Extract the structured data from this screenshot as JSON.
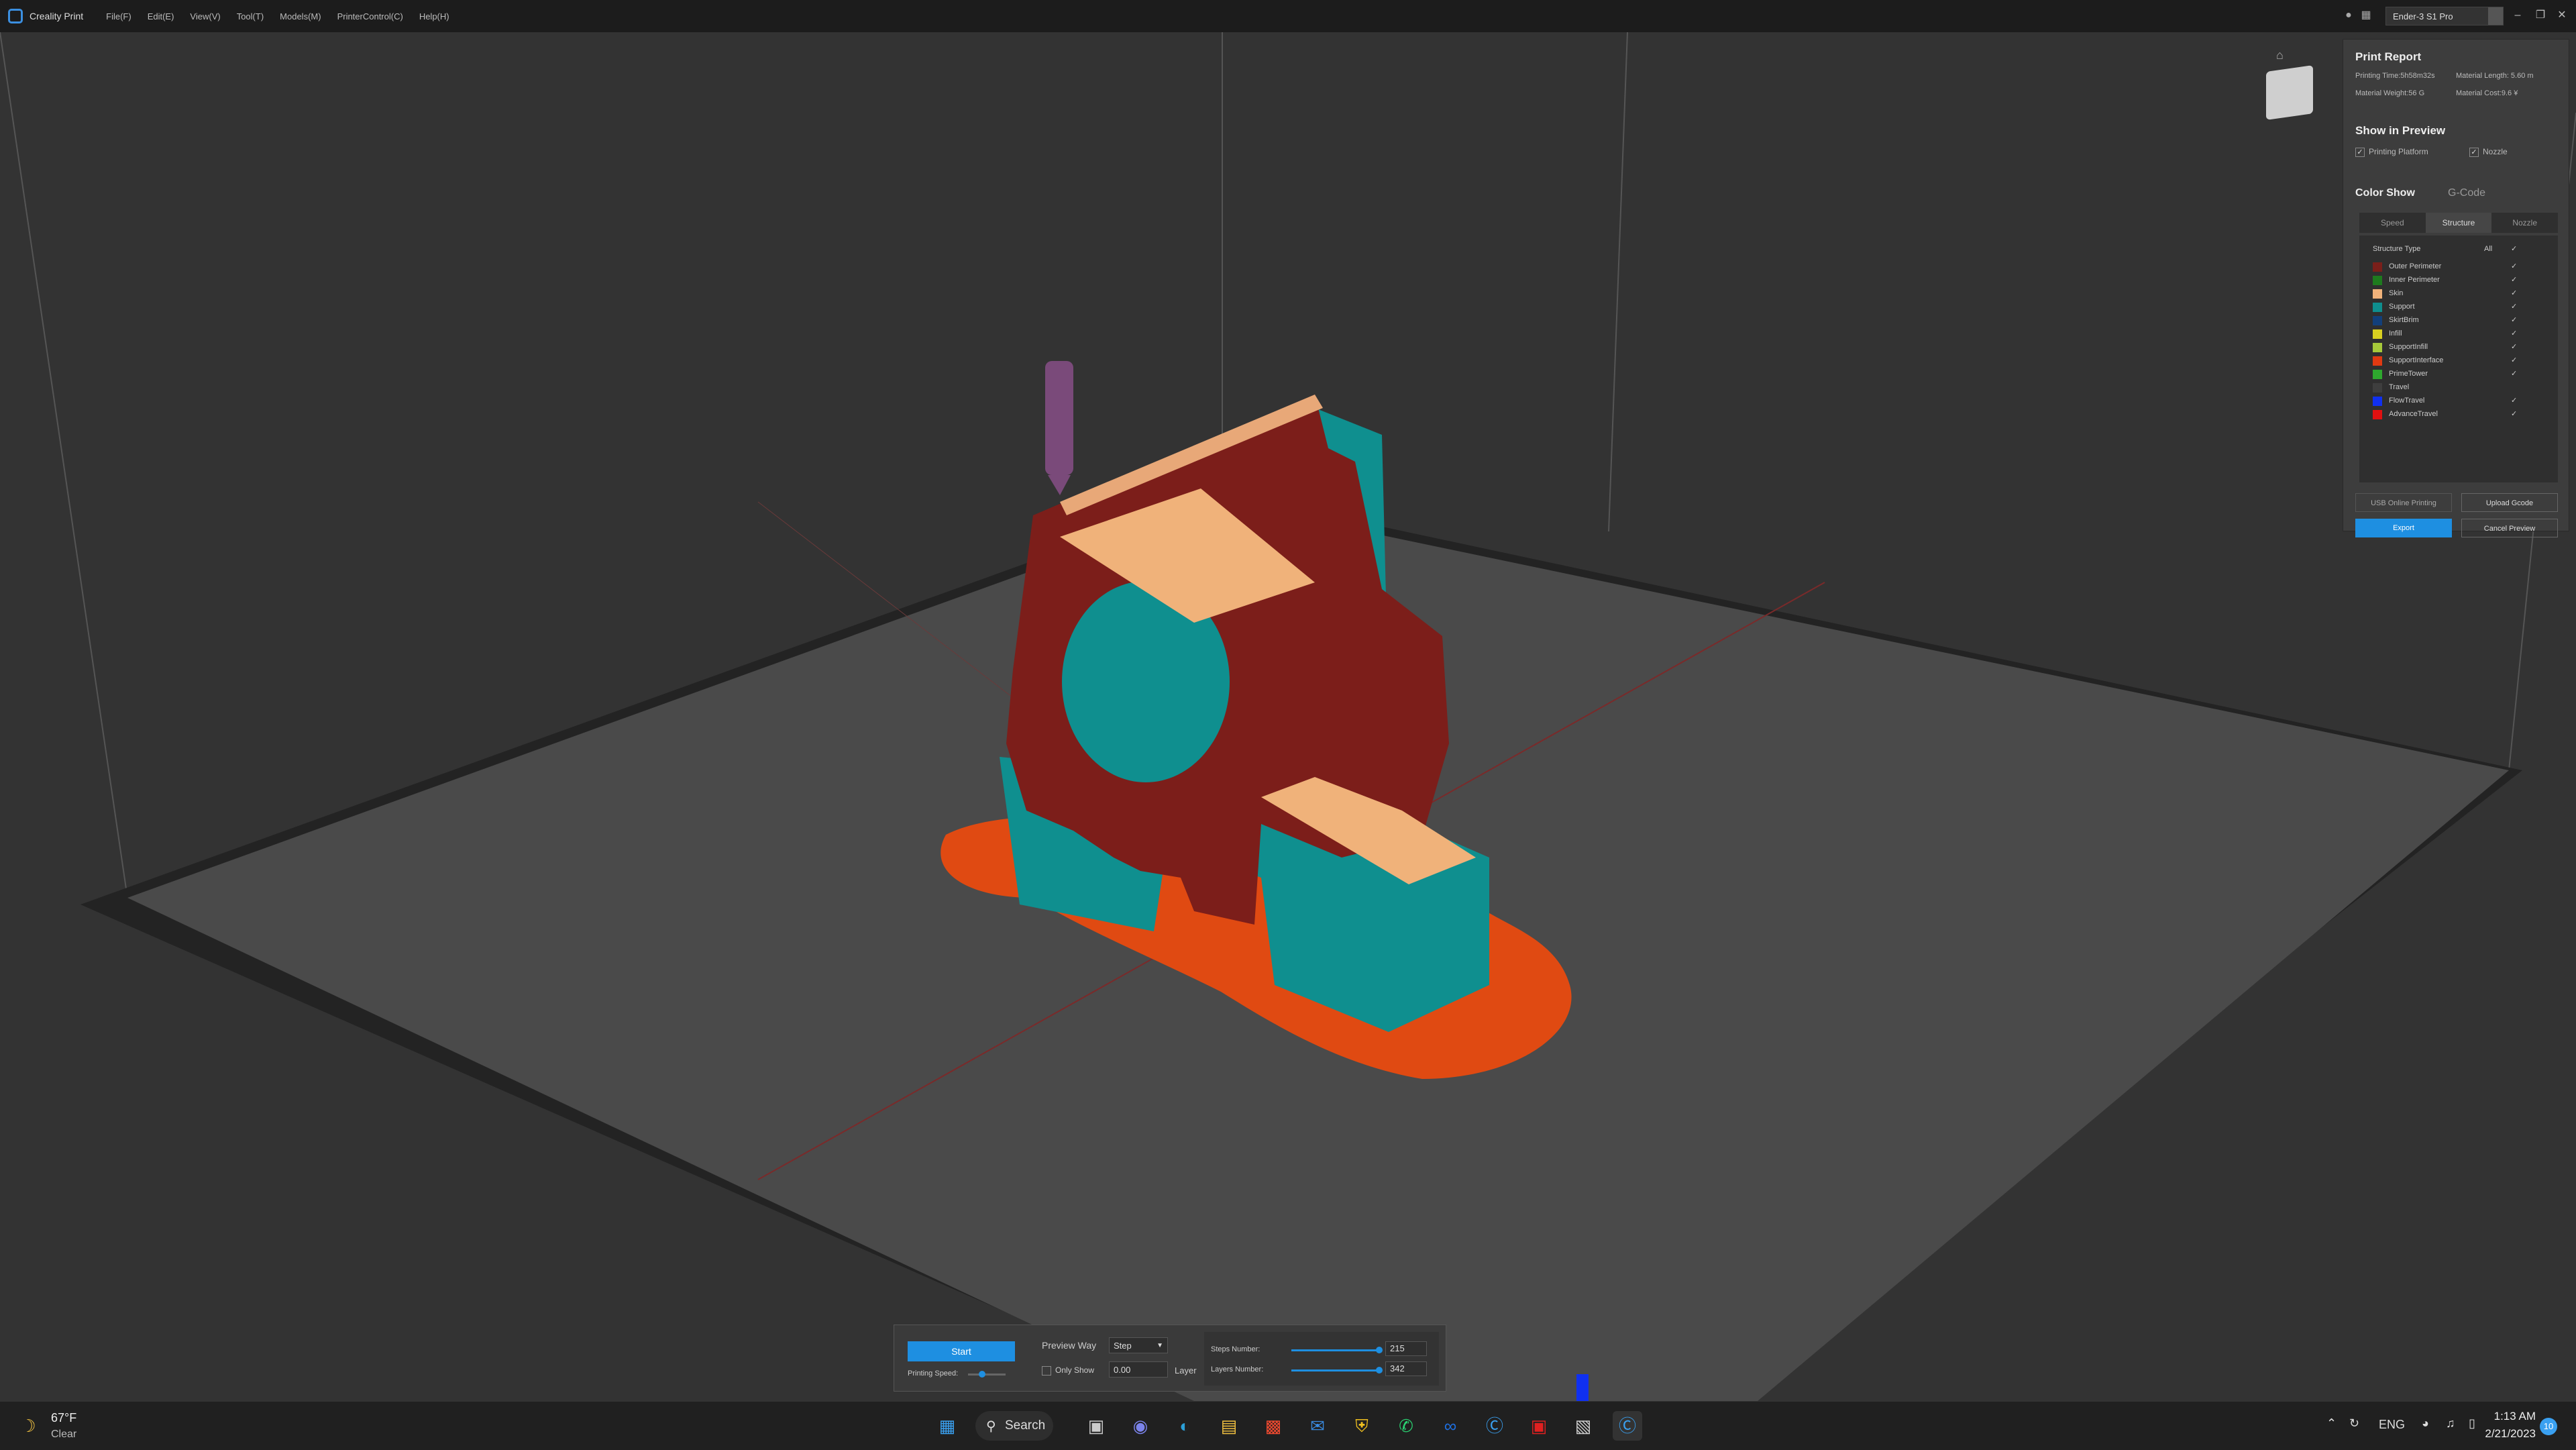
{
  "app": {
    "title": "Creality Print"
  },
  "menu": [
    "File(F)",
    "Edit(E)",
    "View(V)",
    "Tool(T)",
    "Models(M)",
    "PrinterControl(C)",
    "Help(H)"
  ],
  "printer": {
    "selected": "Ender-3 S1 Pro"
  },
  "report": {
    "title": "Print Report",
    "printing_time": "Printing Time:5h58m32s",
    "material_length": "Material Length: 5.60 m",
    "material_weight": "Material Weight:56 G",
    "material_cost": "Material Cost:9.6 ¥"
  },
  "show_preview": {
    "title": "Show in Preview",
    "printing_platform": "Printing Platform",
    "nozzle": "Nozzle"
  },
  "color_show": {
    "title": "Color Show",
    "gcode_label": "G-Code",
    "tabs": [
      "Speed",
      "Structure",
      "Nozzle"
    ],
    "structure_type_label": "Structure Type",
    "all_label": "All",
    "items": [
      {
        "label": "Outer Perimeter",
        "color": "#7a1f1a",
        "checked": true
      },
      {
        "label": "Inner Perimeter",
        "color": "#1e7a1e",
        "checked": true
      },
      {
        "label": "Skin",
        "color": "#f0b27a",
        "checked": true
      },
      {
        "label": "Support",
        "color": "#0e8e8e",
        "checked": true
      },
      {
        "label": "SkirtBrim",
        "color": "#123f7a",
        "checked": true
      },
      {
        "label": "Infill",
        "color": "#d8d020",
        "checked": true
      },
      {
        "label": "SupportInfill",
        "color": "#a6c93a",
        "checked": true
      },
      {
        "label": "SupportInterface",
        "color": "#e03a12",
        "checked": true
      },
      {
        "label": "PrimeTower",
        "color": "#2ea82e",
        "checked": true
      },
      {
        "label": "Travel",
        "color": "#3e3e3e",
        "checked": false
      },
      {
        "label": "FlowTravel",
        "color": "#1030f0",
        "checked": true
      },
      {
        "label": "AdvanceTravel",
        "color": "#e01010",
        "checked": true
      }
    ]
  },
  "buttons": {
    "usb_online": "USB Online Printing",
    "upload_gcode": "Upload Gcode",
    "export": "Export",
    "cancel_preview": "Cancel Preview"
  },
  "preview_bar": {
    "start": "Start",
    "printing_speed": "Printing Speed:",
    "preview_way_label": "Preview Way",
    "preview_way_value": "Step",
    "only_show": "Only Show",
    "only_show_value": "0.00",
    "layer": "Layer",
    "steps_label": "Steps Number:",
    "steps_value": "215",
    "layers_label": "Layers Number:",
    "layers_value": "342"
  },
  "weather": {
    "temp": "67°F",
    "condition": "Clear"
  },
  "taskbar": {
    "search": "Search",
    "lang": "ENG",
    "time": "1:13 AM",
    "date": "2/21/2023",
    "notifications": "10"
  }
}
